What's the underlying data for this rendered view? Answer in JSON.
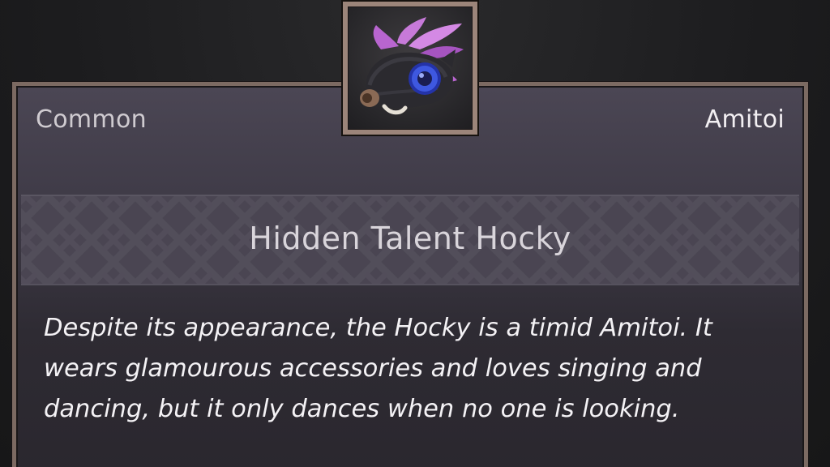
{
  "item": {
    "rarity": "Common",
    "category": "Amitoi",
    "name": "Hidden Talent Hocky",
    "description": "Despite its appearance, the Hocky is a timid Amitoi. It wears glamourous accessories and loves singing and dancing, but it only dances when no one is looking.",
    "icon": "hocky-amitoi-icon"
  },
  "colors": {
    "frame": "#7c6a62",
    "card_top": "#4b4654",
    "card_bottom": "#2a272e",
    "title_band": "#4a4652",
    "text_primary": "#f4f2f5",
    "text_muted": "#cfcbd0",
    "feather": "#c77ad9",
    "eye": "#3344cc"
  }
}
